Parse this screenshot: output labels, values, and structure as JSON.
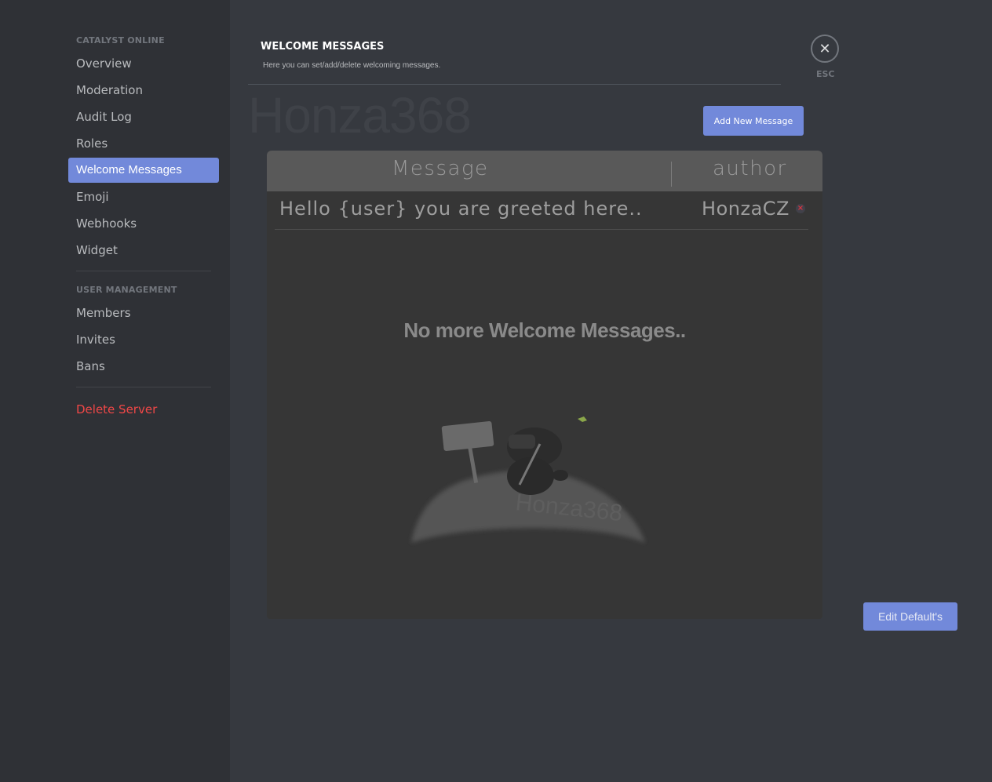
{
  "sidebar": {
    "sections": [
      {
        "header": "CATALYST ONLINE",
        "items": [
          {
            "label": "Overview",
            "active": false
          },
          {
            "label": "Moderation",
            "active": false
          },
          {
            "label": "Audit Log",
            "active": false
          },
          {
            "label": "Roles",
            "active": false
          },
          {
            "label": "Welcome Messages",
            "active": true
          },
          {
            "label": "Emoji",
            "active": false
          },
          {
            "label": "Webhooks",
            "active": false
          },
          {
            "label": "Widget",
            "active": false
          }
        ]
      },
      {
        "header": "USER MANAGEMENT",
        "items": [
          {
            "label": "Members"
          },
          {
            "label": "Invites"
          },
          {
            "label": "Bans"
          }
        ]
      }
    ],
    "danger_item": "Delete Server"
  },
  "header": {
    "title": "WELCOME MESSAGES",
    "subtitle": "Here you can set/add/delete welcoming messages.",
    "watermark": "Honza368"
  },
  "close": {
    "icon": "close-icon",
    "glyph": "✕",
    "label": "ESC"
  },
  "buttons": {
    "add_new_message": "Add New Message",
    "edit_defaults": "Edit Default's"
  },
  "table": {
    "columns": [
      "Message",
      "author"
    ],
    "rows": [
      {
        "message": "Hello {user} you are greeted here..",
        "author": "HonzaCZ",
        "delete_glyph": "×"
      }
    ],
    "empty_text": "No more Welcome Messages..",
    "illustration_watermark": "Honza368"
  },
  "colors": {
    "accent": "#7289da",
    "danger": "#f04747",
    "sidebar_bg": "#2f3136",
    "content_bg": "#36393f"
  }
}
